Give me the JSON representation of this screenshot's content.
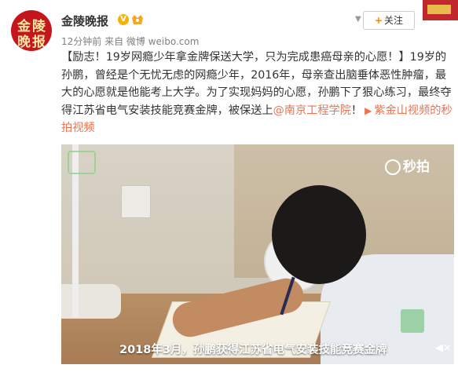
{
  "header": {
    "account_name": "金陵晚报",
    "verified_badge": "V",
    "avatar_text": [
      "金",
      "陵",
      "晚",
      "报"
    ],
    "meta": "12分钟前 来自 微博 weibo.com",
    "follow_label": "关注",
    "follow_icon": "plus-icon",
    "dropdown_icon": "chevron-down-icon"
  },
  "post": {
    "text_before_link": "【励志！19岁网瘾少年拿金牌保送大学，只为完成患癌母亲的心愿！】19岁的孙鹏，曾经是个无忧无虑的网瘾少年，2016年，母亲查出脑垂体恶性肿瘤，最大的心愿就是他能考上大学。为了实现妈妈的心愿，孙鹏下了狠心练习，最终夺得江苏省电气安装技能竞赛金牌，被保送上",
    "mention": "@南京工程学院",
    "text_after_mention": "！",
    "video_link_icon": "video-link-icon",
    "video_link": "紫金山视频的秒拍视频"
  },
  "video": {
    "brand": "秒拍",
    "caption": "2018年3月，孙鹏获得江苏省电气安装技能竞赛金牌",
    "mute_icon": "mute-icon"
  },
  "colors": {
    "link": "#eb7350",
    "follow_plus": "#ff8200",
    "avatar_bg": "#c4161c",
    "verified": "#f7b300"
  }
}
